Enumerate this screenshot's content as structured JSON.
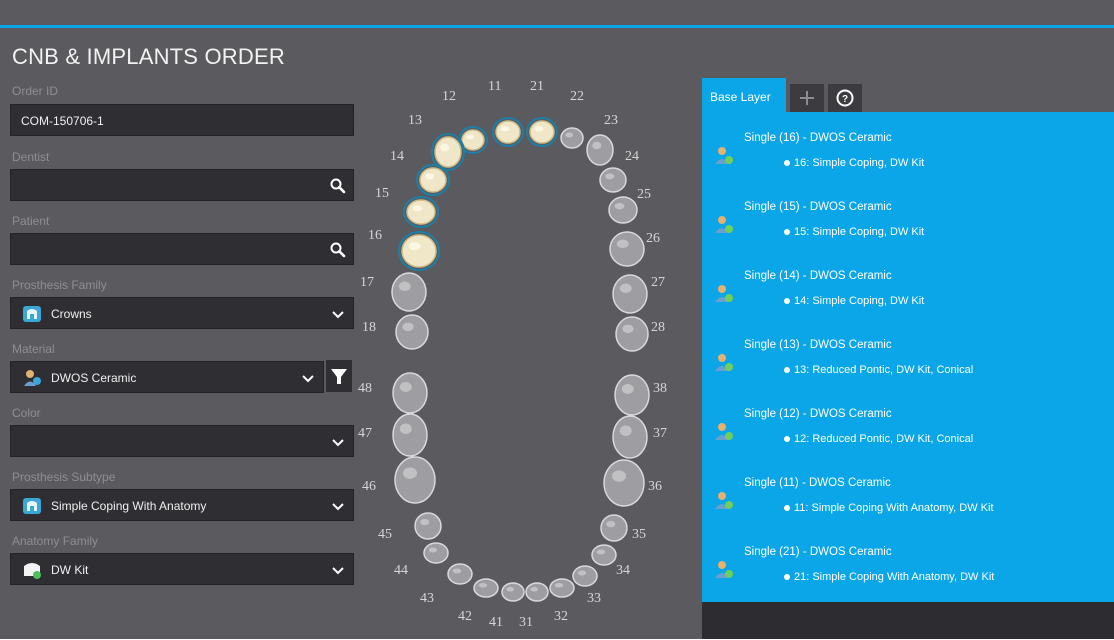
{
  "app": {
    "title": "CNB & IMPLANTS ORDER"
  },
  "form": {
    "order_id": {
      "label": "Order ID",
      "value": "COM-150706-1"
    },
    "dentist": {
      "label": "Dentist",
      "value": ""
    },
    "patient": {
      "label": "Patient",
      "value": ""
    },
    "prosthesis_family": {
      "label": "Prosthesis Family",
      "value": "Crowns"
    },
    "material": {
      "label": "Material",
      "value": "DWOS Ceramic"
    },
    "color": {
      "label": "Color",
      "value": ""
    },
    "prosthesis_subtype": {
      "label": "Prosthesis Subtype",
      "value": "Simple Coping With Anatomy"
    },
    "anatomy_family": {
      "label": "Anatomy Family",
      "value": "DW Kit"
    }
  },
  "tooth_chart": {
    "numbers": [
      "11",
      "12",
      "13",
      "14",
      "15",
      "16",
      "17",
      "18",
      "48",
      "47",
      "46",
      "45",
      "44",
      "43",
      "42",
      "41",
      "31",
      "32",
      "33",
      "34",
      "35",
      "36",
      "37",
      "38",
      "28",
      "27",
      "26",
      "25",
      "24",
      "23",
      "22",
      "21"
    ],
    "selected": [
      "11",
      "12",
      "13",
      "14",
      "15",
      "16",
      "21"
    ]
  },
  "panel": {
    "tabs": {
      "base": "Base Layer",
      "add": "+",
      "help": "?"
    },
    "items": [
      {
        "title": "Single (16) - DWOS Ceramic",
        "detail": "16: Simple Coping, DW Kit"
      },
      {
        "title": "Single (15) - DWOS Ceramic",
        "detail": "15: Simple Coping, DW Kit"
      },
      {
        "title": "Single (14) - DWOS Ceramic",
        "detail": "14: Simple Coping, DW Kit"
      },
      {
        "title": "Single (13) - DWOS Ceramic",
        "detail": "13: Reduced Pontic, DW Kit, Conical"
      },
      {
        "title": "Single (12) - DWOS Ceramic",
        "detail": "12: Reduced Pontic, DW Kit, Conical"
      },
      {
        "title": "Single (11) - DWOS Ceramic",
        "detail": "11: Simple Coping With Anatomy, DW Kit"
      },
      {
        "title": "Single (21) - DWOS Ceramic",
        "detail": "21: Simple Coping With Anatomy, DW Kit"
      }
    ]
  },
  "colors": {
    "accent": "#0ba6e7",
    "background": "#5b5a5f",
    "field": "#2f2e33"
  }
}
